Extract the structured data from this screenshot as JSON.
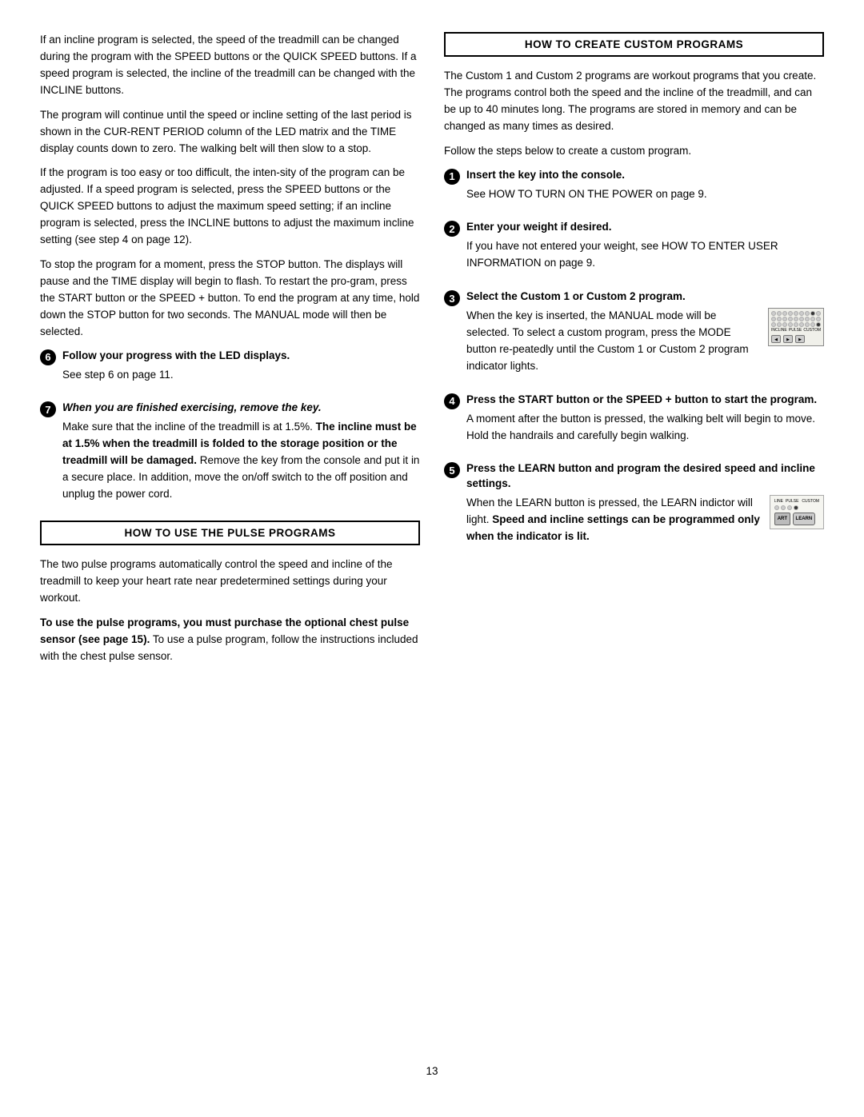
{
  "page": {
    "number": "13"
  },
  "left_col": {
    "para1": "If an incline program is selected, the speed of the treadmill can be changed during the program with the SPEED buttons or the QUICK SPEED buttons. If a speed program is selected, the incline of the treadmill can be changed with the INCLINE buttons.",
    "para2": "The program will continue until the speed or incline setting of the last period is shown in the CUR-RENT PERIOD column of the LED matrix and the TIME display counts down to zero. The walking belt will then slow to a stop.",
    "para3": "If the program is too easy or too difficult, the inten-sity of the program can be adjusted. If a speed program is selected, press the SPEED buttons or the QUICK SPEED buttons to adjust the maximum speed setting; if an incline program is selected, press the INCLINE buttons to adjust the maximum incline setting (see step 4 on page 12).",
    "para4": "To stop the program for a moment, press the STOP button. The displays will pause and the TIME display will begin to flash. To restart the pro-gram, press the START button or the SPEED + button. To end the program at any time, hold down the STOP button for two seconds. The MANUAL mode will then be selected.",
    "step6_number": "6",
    "step6_title": "Follow your progress with the LED displays.",
    "step6_sub": "See step 6 on page 11.",
    "step7_number": "7",
    "step7_title": "When you are finished exercising, remove the key.",
    "step7_body1": "Make sure that the incline of the treadmill is at 1.5%.",
    "step7_body1_bold": "The incline must be at 1.5% when the treadmill is folded to the storage position or the treadmill will be damaged.",
    "step7_body2": "Remove the key from the console and put it in a secure place. In addition, move the on/off switch to the off position and unplug the power cord.",
    "pulse_section_title": "HOW TO USE THE PULSE PROGRAMS",
    "pulse_para1": "The two pulse programs automatically control the speed and incline of the treadmill to keep your heart rate near predetermined settings during your workout.",
    "pulse_para2_start": "To use the pulse programs, you must purchase the optional chest pulse sensor (see page 15).",
    "pulse_para2_end": " To use a pulse program, follow the instructions included with the chest pulse sensor."
  },
  "right_col": {
    "custom_section_title": "HOW TO CREATE CUSTOM PROGRAMS",
    "custom_intro": "The Custom 1 and Custom 2 programs are workout programs that you create. The programs control both the speed and the incline of the treadmill, and can be up to 40 minutes long. The programs are stored in memory and can be changed as many times as desired.",
    "custom_follow": "Follow the steps below to create a custom program.",
    "step1_number": "1",
    "step1_title": "Insert the key into the console.",
    "step1_sub": "See HOW TO TURN ON THE POWER on page 9.",
    "step2_number": "2",
    "step2_title": "Enter your weight if desired.",
    "step2_sub": "If you have not entered your weight, see HOW TO ENTER USER INFORMATION on page 9.",
    "step3_number": "3",
    "step3_title": "Select the Custom 1 or Custom 2 program.",
    "step3_body": "When the key is inserted, the MANUAL mode will be selected. To select a custom program, press the MODE button re-peatedly until the Custom 1 or Custom 2 program indicator lights.",
    "step4_number": "4",
    "step4_title": "Press the START button or the SPEED + button to start the program.",
    "step4_body": "A moment after the button is pressed, the walking belt will begin to move. Hold the handrails and carefully begin walking.",
    "step5_number": "5",
    "step5_title": "Press the LEARN button and program the desired speed and incline settings.",
    "step5_body1": "When the LEARN button is pressed, the LEARN indictor will light.",
    "step5_body2_bold": "Speed and incline settings can be programmed only when the indicator is lit."
  }
}
